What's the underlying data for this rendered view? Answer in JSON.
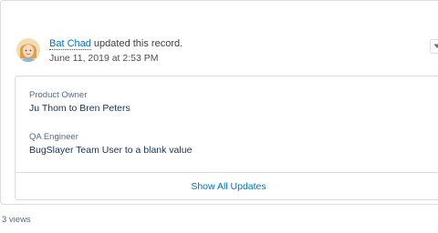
{
  "feed_item": {
    "author": "Bat Chad",
    "action_text": " updated this record.",
    "timestamp": "June 11, 2019 at 2:53 PM",
    "changes": [
      {
        "field": "Product Owner",
        "value": "Ju Thom to Bren Peters"
      },
      {
        "field": "QA Engineer",
        "value": "BugSlayer Team User to a blank value"
      }
    ],
    "show_all_label": "Show All Updates"
  },
  "views_text": "3 views",
  "colors": {
    "link": "#0070d2",
    "border": "#dddbda",
    "label": "#54698d",
    "value": "#16325c"
  },
  "icons": {
    "avatar": "user-avatar-icon",
    "menu": "chevron-down-icon"
  }
}
